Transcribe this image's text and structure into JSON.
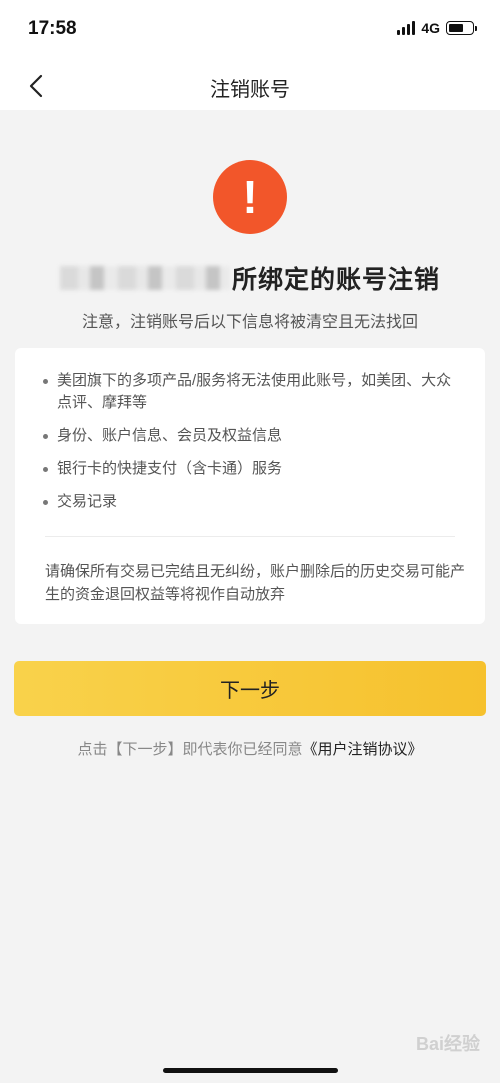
{
  "status_bar": {
    "time": "17:58",
    "network": "4G"
  },
  "nav": {
    "title": "注销账号"
  },
  "heading": {
    "text": "所绑定的账号注销",
    "subtitle": "注意，注销账号后以下信息将被清空且无法找回"
  },
  "info": {
    "items": [
      "美团旗下的多项产品/服务将无法使用此账号，如美团、大众点评、摩拜等",
      "身份、账户信息、会员及权益信息",
      "银行卡的快捷支付（含卡通）服务",
      "交易记录"
    ],
    "note": "请确保所有交易已完结且无纠纷，账户删除后的历史交易可能产生的资金退回权益等将视作自动放弃"
  },
  "actions": {
    "next_label": "下一步"
  },
  "agreement": {
    "prefix": "点击【下一步】即代表你已经同意",
    "link": "《用户注销协议》"
  },
  "watermark": {
    "text": "Bai经验"
  },
  "colors": {
    "accent": "#f6c12d",
    "alert": "#f2562a",
    "background": "#f3f3f3"
  },
  "icons": {
    "back": "chevron-left-icon",
    "alert": "exclamation-icon"
  }
}
